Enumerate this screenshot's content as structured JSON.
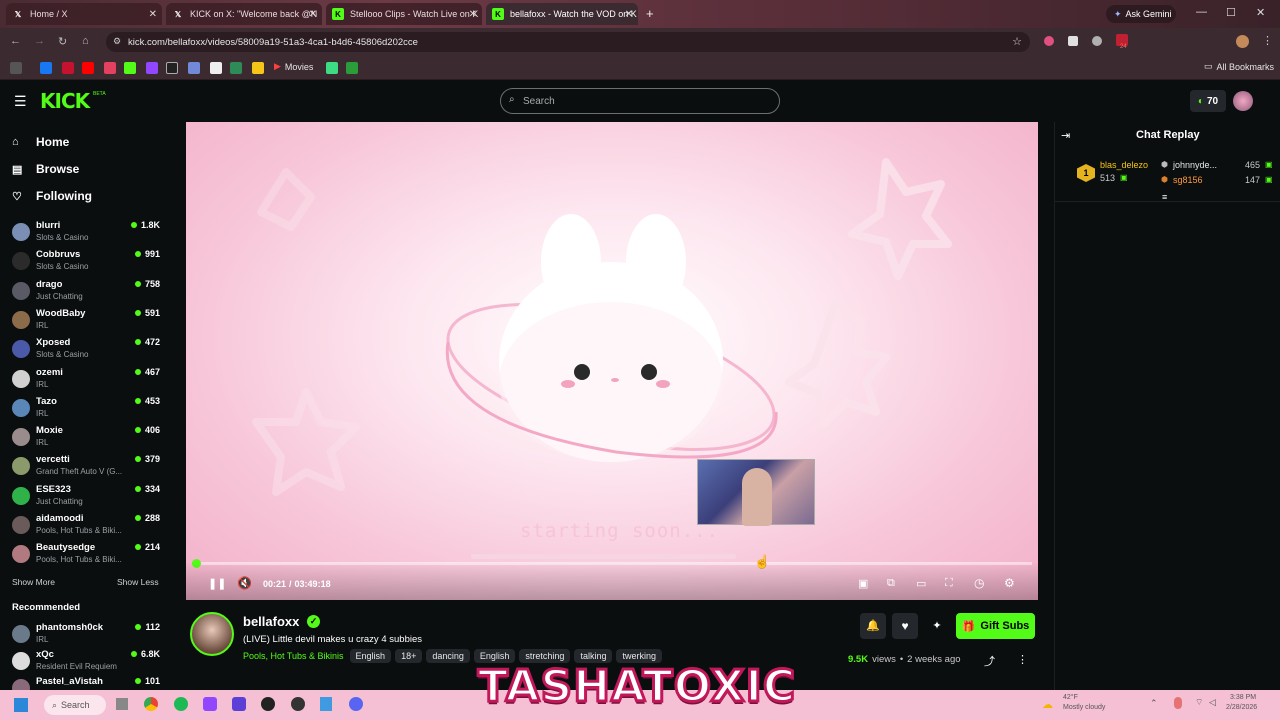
{
  "browser": {
    "tabs": [
      {
        "title": "Home / X",
        "icon": "x-logo-icon"
      },
      {
        "title": "KICK on X: \"Welcome back @N",
        "icon": "x-logo-icon"
      },
      {
        "title": "Stellooo Clips - Watch Live on K",
        "icon": "kick-logo-icon"
      },
      {
        "title": "bellafoxx - Watch the VOD on K",
        "icon": "kick-logo-icon"
      }
    ],
    "url": "kick.com/bellafoxx/videos/58009a19-51a3-4ca1-b4d6-45806d202cce",
    "ask_gemini": "Ask Gemini",
    "bookmarks_movies": "Movies",
    "all_bookmarks": "All Bookmarks",
    "extension_badge": "24"
  },
  "header": {
    "logo": "KICK",
    "logo_beta": "BETA",
    "search_placeholder": "Search",
    "points": "70"
  },
  "sidebar": {
    "nav": [
      {
        "label": "Home",
        "icon": "home-icon"
      },
      {
        "label": "Browse",
        "icon": "browse-icon"
      },
      {
        "label": "Following",
        "icon": "heart-icon"
      }
    ],
    "following": [
      {
        "name": "blurri",
        "category": "Slots & Casino",
        "viewers": "1.8K",
        "color": "#7a8fb3"
      },
      {
        "name": "Cobbruvs",
        "category": "Slots & Casino",
        "viewers": "991",
        "color": "#2b2b2b"
      },
      {
        "name": "drago",
        "category": "Just Chatting",
        "viewers": "758",
        "color": "#5a5a66"
      },
      {
        "name": "WoodBaby",
        "category": "IRL",
        "viewers": "591",
        "color": "#8b6b4a"
      },
      {
        "name": "Xposed",
        "category": "Slots & Casino",
        "viewers": "472",
        "color": "#4a5aa8"
      },
      {
        "name": "ozemi",
        "category": "IRL",
        "viewers": "467",
        "color": "#d0d0d0"
      },
      {
        "name": "Tazo",
        "category": "IRL",
        "viewers": "453",
        "color": "#5a86b8"
      },
      {
        "name": "Moxie",
        "category": "IRL",
        "viewers": "406",
        "color": "#9a8c8c"
      },
      {
        "name": "vercetti",
        "category": "Grand Theft Auto V (G...",
        "viewers": "379",
        "color": "#8a9a6a"
      },
      {
        "name": "ESE323",
        "category": "Just Chatting",
        "viewers": "334",
        "color": "#2fb24a"
      },
      {
        "name": "aidamoodi",
        "category": "Pools, Hot Tubs & Biki...",
        "viewers": "288",
        "color": "#6a5a5a"
      },
      {
        "name": "Beautysedge",
        "category": "Pools, Hot Tubs & Biki...",
        "viewers": "214",
        "color": "#b07a80"
      }
    ],
    "show_more": "Show More",
    "show_less": "Show Less",
    "recommended_title": "Recommended",
    "recommended": [
      {
        "name": "phantomsh0ck",
        "category": "IRL",
        "viewers": "112",
        "color": "#6a7a8a"
      },
      {
        "name": "xQc",
        "category": "Resident Evil Requiem",
        "viewers": "6.8K",
        "color": "#dcdcdc"
      },
      {
        "name": "Pastel_aVistah",
        "category": "",
        "viewers": "101",
        "color": "#8a6a7a"
      }
    ]
  },
  "player": {
    "overlay_text": "starting soon...",
    "time_current": "00:21",
    "time_separator": "/",
    "time_total": "03:49:18",
    "progress": 0.002
  },
  "stream": {
    "streamer": "bellafoxx",
    "title": "(LIVE) Little devil makes u crazy 4 subbies",
    "category": "Pools, Hot Tubs & Bikinis",
    "tags": [
      "English",
      "18+",
      "dancing",
      "English",
      "stretching",
      "talking",
      "twerking"
    ],
    "gift_subs": "Gift Subs",
    "views": "9.5K",
    "views_label": "views",
    "separator": "•",
    "ago": "2 weeks ago"
  },
  "chat": {
    "title": "Chat Replay",
    "leaderboard": [
      {
        "rank": "1",
        "name": "blas_delezo",
        "count": "513"
      },
      {
        "name": "johnnyde...",
        "count": "465"
      },
      {
        "name": "sg8156",
        "count": "147"
      }
    ]
  },
  "taskbar": {
    "search": "Search",
    "weather_temp": "42°F",
    "weather_desc": "Mostly cloudy",
    "time": "3:38 PM",
    "date": "2/28/2026"
  },
  "watermark": "TASHATOXIC",
  "colors": {
    "kick_green": "#53fc18",
    "bg": "#0b0e0f"
  }
}
